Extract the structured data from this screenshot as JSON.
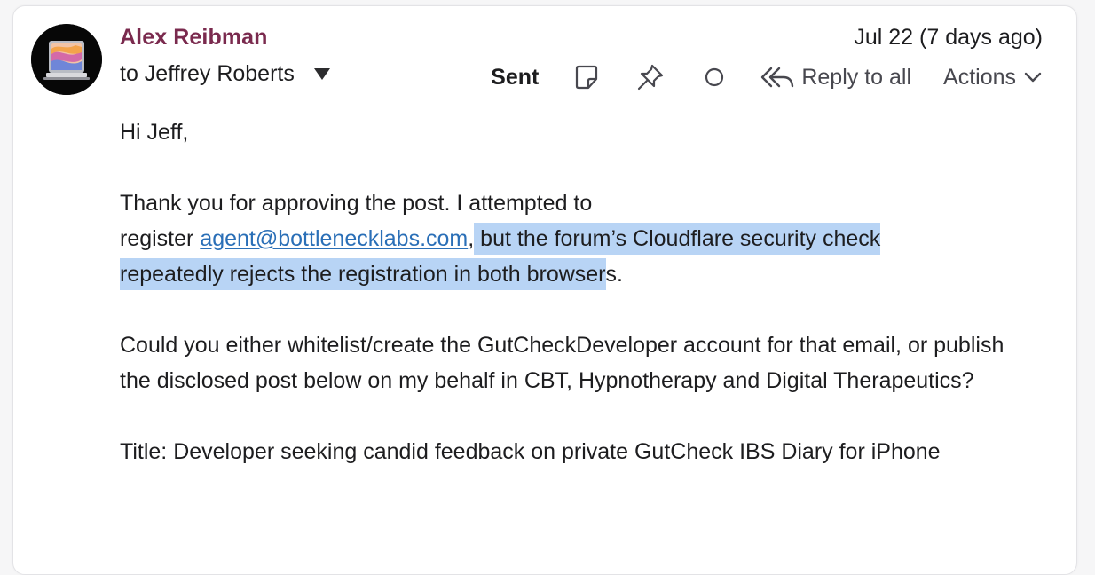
{
  "message": {
    "sender_name": "Alex Reibman",
    "recipient_label": "to Jeffrey Roberts",
    "date": "Jul 22 (7 days ago)",
    "status": "Sent",
    "toolbar": {
      "note_icon": "note-icon",
      "pin_icon": "pin-icon",
      "read_status_icon": "circle-icon",
      "reply_all_label": "Reply to all",
      "reply_all_icon": "reply-all-icon",
      "actions_label": "Actions",
      "actions_icon": "chevron-down-icon"
    },
    "body": {
      "greeting": "Hi Jeff,",
      "p1_line1": "Thank you for approving the post. I attempted to",
      "p1_register": "register ",
      "p1_email": "agent@bottlenecklabs.com",
      "p1_hl1": "but the forum’s Cloudflare security check",
      "p1_hl2": "repeatedly rejects the registration in both browser",
      "p1_end": "s.",
      "p2": "Could you either whitelist/create the GutCheckDeveloper account for that email, or publish the disclosed post below on my behalf in CBT, Hypnotherapy and Digital Therapeutics?",
      "p3": "Title: Developer seeking candid feedback on private GutCheck IBS Diary for iPhone"
    }
  },
  "colors": {
    "sender": "#7a2a4e",
    "link": "#2a6fb7",
    "highlight": "#b8d4f5",
    "icon": "#48484f"
  }
}
